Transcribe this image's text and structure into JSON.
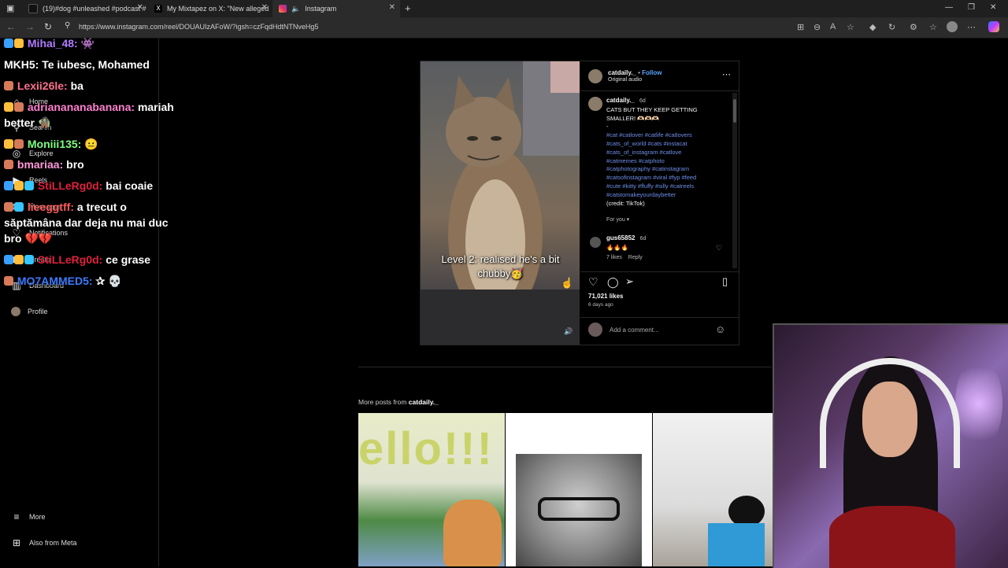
{
  "browser": {
    "tabs": [
      {
        "title": "(19)#dog #unleashed #podcast #",
        "favicon_color": "#111111"
      },
      {
        "title": "My Mixtapez on X: \"New alleged",
        "favicon_color": "#111111"
      },
      {
        "title": "Instagram",
        "favicon_color": "#e1306c"
      }
    ],
    "url": "https://www.instagram.com/reel/DOUAUIzAFoW/?igsh=czFqdHdtNTNveHg5"
  },
  "sidebar": {
    "items": [
      {
        "label": "Home",
        "icon": "home-icon"
      },
      {
        "label": "Search",
        "icon": "search-icon"
      },
      {
        "label": "Explore",
        "icon": "compass-icon"
      },
      {
        "label": "Reels",
        "icon": "reels-icon"
      },
      {
        "label": "Messages",
        "icon": "messenger-icon"
      },
      {
        "label": "Notifications",
        "icon": "heart-icon"
      },
      {
        "label": "Create",
        "icon": "plus-icon"
      },
      {
        "label": "Dashboard",
        "icon": "dashboard-icon"
      },
      {
        "label": "Profile",
        "icon": "avatar"
      }
    ],
    "bottom": [
      {
        "label": "More",
        "icon": "menu-icon"
      },
      {
        "label": "Also from Meta",
        "icon": "meta-icon"
      }
    ]
  },
  "chat": [
    {
      "user": "Mihai_48:",
      "msg": "",
      "color": "#b07aff"
    },
    {
      "user": "MKH5:",
      "msg": "Te iubesc, Mohamed",
      "color": "#ffffff"
    },
    {
      "user": "Lexii26le:",
      "msg": "ba",
      "color": "#ff6f8e"
    },
    {
      "user": "adrianananabanana:",
      "msg": "mariah",
      "color": "#ff7fd0"
    },
    {
      "user": "",
      "msg": "better",
      "color": "#ffffff"
    },
    {
      "user": "Moniii135:",
      "msg": "",
      "color": "#7fff7f"
    },
    {
      "user": "bmariaa:",
      "msg": "bro",
      "color": "#ff9ad9"
    },
    {
      "user": "StiLLeRg0d:",
      "msg": "bai coaie",
      "color": "#e0203c"
    },
    {
      "user": "lieeggtff:",
      "msg": "a trecut o",
      "color": "#ff5a5a"
    },
    {
      "user": "",
      "msg": "săptămâna dar deja nu mai duc",
      "color": "#ffffff"
    },
    {
      "user": "",
      "msg": "bro",
      "color": "#ffffff"
    },
    {
      "user": "StiLLeRg0d:",
      "msg": "ce grase",
      "color": "#e0203c"
    },
    {
      "user": "MO7AMMED5:",
      "msg": "",
      "color": "#3b7bff"
    }
  ],
  "post": {
    "username": "catdaily._",
    "follow": "Follow",
    "dot": "•",
    "audio": "Original audio",
    "caption_user": "catdaily._",
    "caption_time": "6d",
    "caption_line1": "CATS BUT THEY KEEP GETTING",
    "caption_line2": "SMALLER! 🫶🏻🫶🏻🫶🏻",
    "caption_dash": "-",
    "hashtags": [
      "#cat #catlover #catlife #catlovers",
      "#cats_of_world #cats #instacat",
      "#cats_of_instagram #catlove",
      "#catmemes #catphoto",
      "#catphotography #catinstagram",
      "#catsofinstagram #viral #fyp #feed",
      "#cute #kitty #fluffy #silly #catreels",
      "#catstomakeyourdaybetter"
    ],
    "credit": "(credit: TikTok)",
    "for_you": "For you ▾",
    "comment_user": "gus65852",
    "comment_time": "6d",
    "comment_text": "🔥🔥🔥",
    "comment_likes": "7 likes",
    "comment_reply": "Reply",
    "likes": "71,021 likes",
    "ago": "6 days ago",
    "add_comment_placeholder": "Add a comment...",
    "video_caption": "Level 2: realised he's a bit chubby🥳"
  },
  "more_posts": {
    "label": "More posts from",
    "user": "catdaily._"
  },
  "thumbs": [
    {
      "text": "ello!!!",
      "color": "#c9d36a"
    },
    {
      "text": "",
      "color": "#bfbfbf"
    },
    {
      "text": "",
      "color": "#cfcfcf"
    }
  ]
}
